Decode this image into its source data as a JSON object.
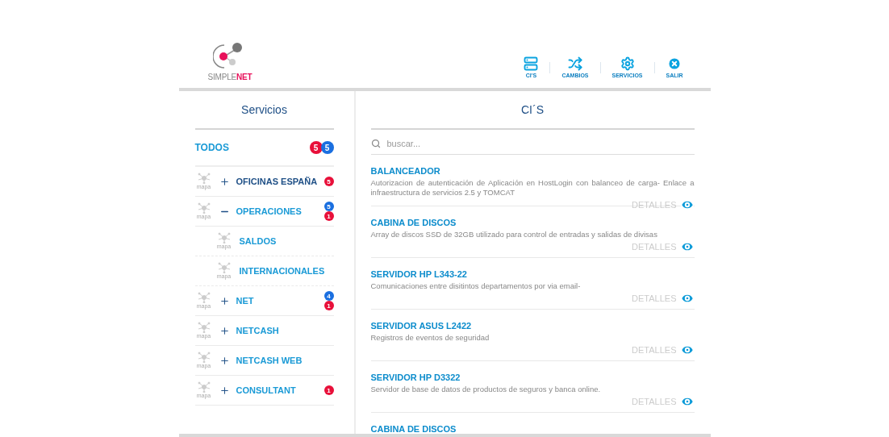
{
  "logo": {
    "text": "SIMPLE**NET**"
  },
  "nav": [
    {
      "label": "CI'S",
      "kind": "server"
    },
    {
      "label": "CAMBIOS",
      "kind": "shuffle"
    },
    {
      "label": "SERVICIOS",
      "kind": "gear"
    },
    {
      "label": "SALIR",
      "kind": "close"
    }
  ],
  "sidebar": {
    "title": "Servicios",
    "all": {
      "label": "TODOS",
      "badges": [
        {
          "count": "5",
          "color": "#e8103a"
        },
        {
          "count": "5",
          "color": "#1a6fe0"
        }
      ]
    },
    "items": [
      {
        "label": "OFICINAS ESPAÑA",
        "map_label": "mapa",
        "selected": true,
        "expanded": false,
        "badges": [
          {
            "count": "5",
            "color": "#e8103a"
          }
        ]
      },
      {
        "label": "OPERACIONES",
        "map_label": "mapa",
        "selected": false,
        "expanded": true,
        "badges": [
          {
            "count": "5",
            "color": "#1a6fe0"
          },
          {
            "count": "1",
            "color": "#e8103a"
          }
        ],
        "children": [
          {
            "label": "SALDOS",
            "map_label": "mapa",
            "selected": false
          },
          {
            "label": "INTERNACIONALES",
            "map_label": "mapa",
            "selected": false
          }
        ]
      },
      {
        "label": "NET",
        "map_label": "mapa",
        "selected": false,
        "expanded": false,
        "badges": [
          {
            "count": "4",
            "color": "#1a6fe0"
          },
          {
            "count": "1",
            "color": "#e8103a"
          }
        ]
      },
      {
        "label": "NETCASH",
        "map_label": "mapa",
        "selected": false,
        "expanded": false
      },
      {
        "label": "NETCASH WEB",
        "map_label": "mapa",
        "selected": false,
        "expanded": false
      },
      {
        "label": "CONSULTANT",
        "map_label": "mapa",
        "selected": false,
        "expanded": false,
        "badges": [
          {
            "count": "1",
            "color": "#e8103a"
          }
        ]
      }
    ]
  },
  "main": {
    "title": "CI´S",
    "search": {
      "placeholder": "buscar..."
    },
    "cards": [
      {
        "title": "BALANCEADOR",
        "description": "Autorizacion de autenticación de Aplicación en HostLogin con balanceo de carga- Enlace a infraestructura de servicios 2.5 y TOMCAT",
        "action": "DETALLES"
      },
      {
        "title": "CABINA DE DISCOS",
        "description": "Array de discos SSD de 32GB utilizado para control de entradas y salidas de divisas",
        "action": "DETALLES"
      },
      {
        "title": "SERVIDOR HP L343-22",
        "description": "Comunicaciones entre disitintos departamentos por via email-",
        "action": "DETALLES"
      },
      {
        "title": "SERVIDOR ASUS L2422",
        "description": "Registros de eventos de seguridad",
        "action": "DETALLES"
      },
      {
        "title": "SERVIDOR HP D3322",
        "description": "Servidor de base de datos de productos de seguros y banca online.",
        "action": "DETALLES"
      },
      {
        "title": "CABINA DE DISCOS"
      }
    ]
  }
}
